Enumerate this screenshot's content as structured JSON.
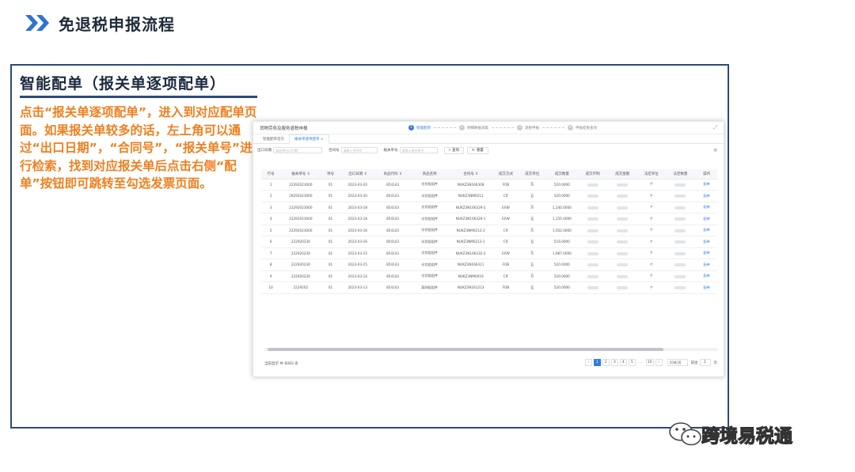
{
  "slide": {
    "title": "免退税申报流程",
    "section_title": "智能配单（报关单逐项配单）",
    "description": "点击“报关单逐项配单”，进入到对应配单页面。如果报关单较多的话，左上角可以通过“出口日期”，“合同号”，“报关单号”进行检索，找到对应报关单后点击右侧“配单”按钮即可跳转至勾选发票页面。"
  },
  "screenshot": {
    "title": "货物劳务及服务退税申报",
    "steps": [
      {
        "num": "1",
        "label": "智能配单"
      },
      {
        "num": "2",
        "label": "明细数据采集"
      },
      {
        "num": "3",
        "label": "退税申报"
      },
      {
        "num": "4",
        "label": "申报结果查询"
      }
    ],
    "tabs": [
      "智能配单首页",
      "报关单逐项配单 ×"
    ],
    "filters": {
      "export_date_label": "出口日期",
      "export_date_placeholder": "请选择出口日期",
      "contract_label": "合同号",
      "contract_placeholder": "请输入合同号",
      "declaration_label": "报关单号",
      "declaration_placeholder": "请输入报关单号",
      "search_label": "查询",
      "reset_label": "重置"
    },
    "columns": [
      "行号",
      "报关单号 ⇕",
      "项号",
      "出口日期 ⇕",
      "商品代码 ⇕",
      "商品名称",
      "合同号 ⇕",
      "成交方式",
      "成交单位",
      "成交数量",
      "成交币制",
      "成交金额",
      "法定单位",
      "法定数量",
      "操作"
    ],
    "rows": [
      [
        "1",
        "22292023000",
        "01",
        "2023-03-20",
        "854143",
        "光伏组组件",
        "NUKZ3N166308",
        "FOB",
        "瓦",
        "520.0000",
        "",
        "",
        "个",
        "",
        "配单"
      ],
      [
        "2",
        "28292023000",
        "01",
        "2023-03-20",
        "854143",
        "光伏组组件",
        "NUKZ3NM0212",
        "CIF",
        "瓦",
        "520.0000",
        "",
        "",
        "个",
        "",
        "配单"
      ],
      [
        "3",
        "22292023000",
        "01",
        "2023-03-18",
        "854143",
        "光伏组组件",
        "NUKZ3N166329-2",
        "EXW",
        "瓦",
        "1,240.0000",
        "",
        "",
        "个",
        "",
        "配单"
      ],
      [
        "4",
        "22292023000",
        "01",
        "2023-03-18",
        "854143",
        "光伏组组件",
        "NUKZ3N166329-1",
        "EXW",
        "瓦",
        "1,155.0000",
        "",
        "",
        "个",
        "",
        "配单"
      ],
      [
        "5",
        "22292023000",
        "01",
        "2023-03-16",
        "854143",
        "光伏组组件",
        "NUKZ3NM0212-2",
        "CIF",
        "瓦",
        "1,502.0000",
        "",
        "",
        "个",
        "",
        "配单"
      ],
      [
        "6",
        "222920230",
        "01",
        "2023-03-16",
        "854143",
        "光伏组组件",
        "NUKZ3NM0212-1",
        "CIF",
        "瓦",
        "516.0000",
        "",
        "",
        "个",
        "",
        "配单"
      ],
      [
        "7",
        "222920230",
        "01",
        "2023-03-15",
        "854143",
        "光伏组组件",
        "NUKZ3N166332-2",
        "EXW",
        "瓦",
        "1,987.0000",
        "",
        "",
        "个",
        "",
        "配单"
      ],
      [
        "8",
        "222920230",
        "01",
        "2023-03-15",
        "854143",
        "光伏组组件",
        "NUKZ3N166311",
        "FOB",
        "瓦",
        "520.0000",
        "",
        "",
        "个",
        "",
        "配单"
      ],
      [
        "9",
        "222920230",
        "01",
        "2023-03-14",
        "854143",
        "光伏组组件",
        "NUKZ3NM0019",
        "CIF",
        "瓦",
        "520.0000",
        "",
        "",
        "个",
        "",
        "配单"
      ],
      [
        "10",
        "2229202",
        "01",
        "2023-03-13",
        "854143",
        "离网组组件",
        "NUKZ3N161213",
        "FOB",
        "瓦",
        "520.0000",
        "",
        "",
        "个",
        "",
        "配单"
      ]
    ],
    "total": "当前显示 共 8083 条",
    "pager": {
      "pages": [
        "1",
        "2",
        "3",
        "4",
        "5",
        "...",
        "10"
      ],
      "page_size": "10条/页",
      "goto_label": "前往",
      "goto_value": "1",
      "page_unit": "页"
    }
  },
  "watermark": {
    "text": "跨境易税通"
  }
}
